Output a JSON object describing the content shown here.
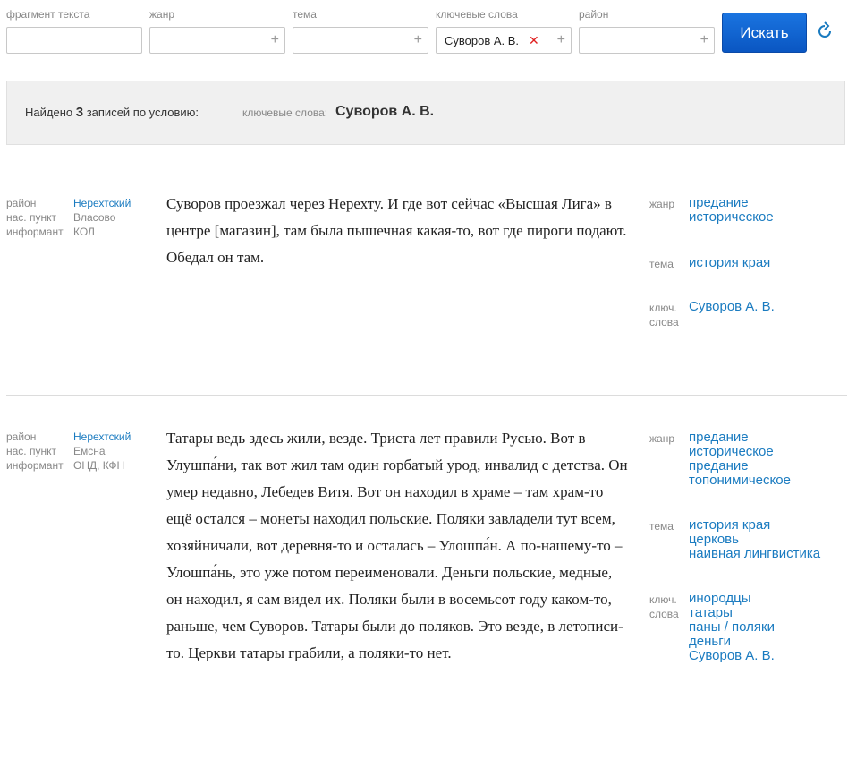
{
  "filters": {
    "fragment_label": "фрагмент текста",
    "genre_label": "жанр",
    "topic_label": "тема",
    "keywords_label": "ключевые слова",
    "district_label": "район",
    "keyword_tag": "Суворов А. В.",
    "search_button": "Искать"
  },
  "summary": {
    "found_prefix": "Найдено",
    "found_count": "3",
    "found_suffix": "записей по условию:",
    "keywords_label": "ключевые слова:",
    "keywords_value": "Суворов А. В."
  },
  "records": [
    {
      "district_label": "район",
      "district": "Нерехтский",
      "settlement_label": "нас. пункт",
      "settlement": "Власово",
      "informant_label": "информант",
      "informant": "КОЛ",
      "text": "Суворов проезжал через Нерехту. И где вот сейчас «Высшая Лига» в центре [магазин], там была пышечная какая-то, вот где пироги подают. Обедал он там.",
      "genre_label": "жанр",
      "genres": [
        "предание историческое"
      ],
      "topic_label": "тема",
      "topics": [
        "история края"
      ],
      "keywords_label": "ключ. слова",
      "keywords": [
        "Суворов А. В."
      ]
    },
    {
      "district_label": "район",
      "district": "Нерехтский",
      "settlement_label": "нас. пункт",
      "settlement": "Емсна",
      "informant_label": "информант",
      "informant": "ОНД, КФН",
      "text": "Татары ведь здесь жили, везде. Триста лет правили Русью. Вот в Улушпа́ни, так вот жил там один горбатый урод, инвалид с детства. Он умер недавно, Лебедев Витя. Вот он находил в храме – там храм-то ещё остался – монеты находил польские. Поляки завладели тут всем, хозяйничали, вот деревня-то и осталась – Улошпа́н. А по-нашему-то – Улошпа́нь, это уже потом переименовали. Деньги польские, медные, он находил, я сам видел их. Поляки были в восемьсот году каком-то, раньше, чем Суворов. Татары были до поляков. Это везде, в летописи-то. Церкви татары грабили, а поляки-то нет.",
      "genre_label": "жанр",
      "genres": [
        "предание историческое",
        "предание топонимическое"
      ],
      "topic_label": "тема",
      "topics": [
        "история края",
        "церковь",
        "наивная лингвистика"
      ],
      "keywords_label": "ключ. слова",
      "keywords": [
        "инородцы",
        "татары",
        "паны / поляки",
        "деньги",
        "Суворов А. В."
      ]
    }
  ]
}
